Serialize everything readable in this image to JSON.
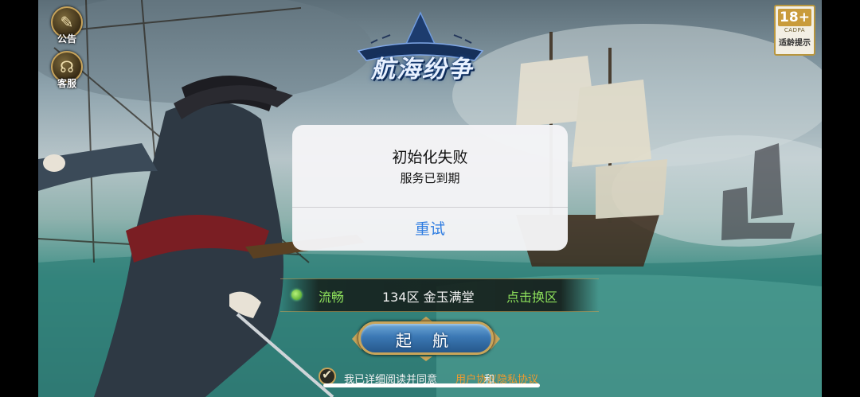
{
  "side_buttons": {
    "notice_label": "公告",
    "service_label": "客服"
  },
  "age_rating": {
    "rating": "18+",
    "org": "CADPA",
    "label": "适龄提示"
  },
  "logo": {
    "title": "航海纷争"
  },
  "server": {
    "status": "流畅",
    "name": "134区 金玉满堂",
    "switch_label": "点击换区",
    "status_color": "#8de05b"
  },
  "start_button": {
    "label": "起 航"
  },
  "agreement": {
    "checked": true,
    "prefix": "我已详细阅读并同意",
    "user_agreement": "用户协议",
    "conjunction": "和",
    "privacy_policy": "隐私协议",
    "link_color": "#f09a2e"
  },
  "alert": {
    "title": "初始化失败",
    "message": "服务已到期",
    "retry_label": "重试",
    "button_color": "#2f7de1"
  }
}
